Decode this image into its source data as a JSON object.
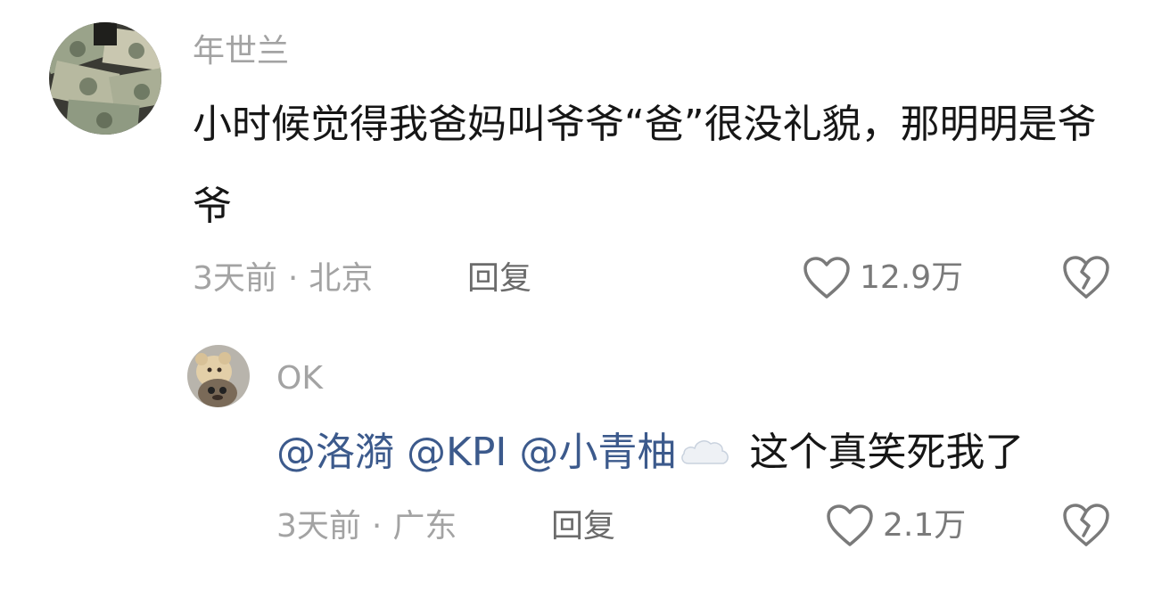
{
  "comment": {
    "author": "年世兰",
    "text": "小时候觉得我爸妈叫爷爷“爸”很没礼貌，那明明是爷爷",
    "time": "3天前",
    "location": "北京",
    "separator": "·",
    "reply_label": "回复",
    "like_count": "12.9万",
    "avatar_icon": "money-stack-avatar",
    "like_icon": "heart-outline-icon",
    "dislike_icon": "broken-heart-icon"
  },
  "reply": {
    "author": "OK",
    "mentions": [
      "@洛漪",
      "@KPI",
      "@小青柚"
    ],
    "emoji": "cloud",
    "text": "这个真笑死我了",
    "time": "3天前",
    "location": "广东",
    "separator": "·",
    "reply_label": "回复",
    "like_count": "2.1万",
    "avatar_icon": "teddy-bear-avatar",
    "like_icon": "heart-outline-icon",
    "dislike_icon": "broken-heart-icon"
  },
  "colors": {
    "text": "#161616",
    "muted": "#a3a3a3",
    "mention": "#3c5a8c",
    "icon": "#7a7a7a"
  }
}
